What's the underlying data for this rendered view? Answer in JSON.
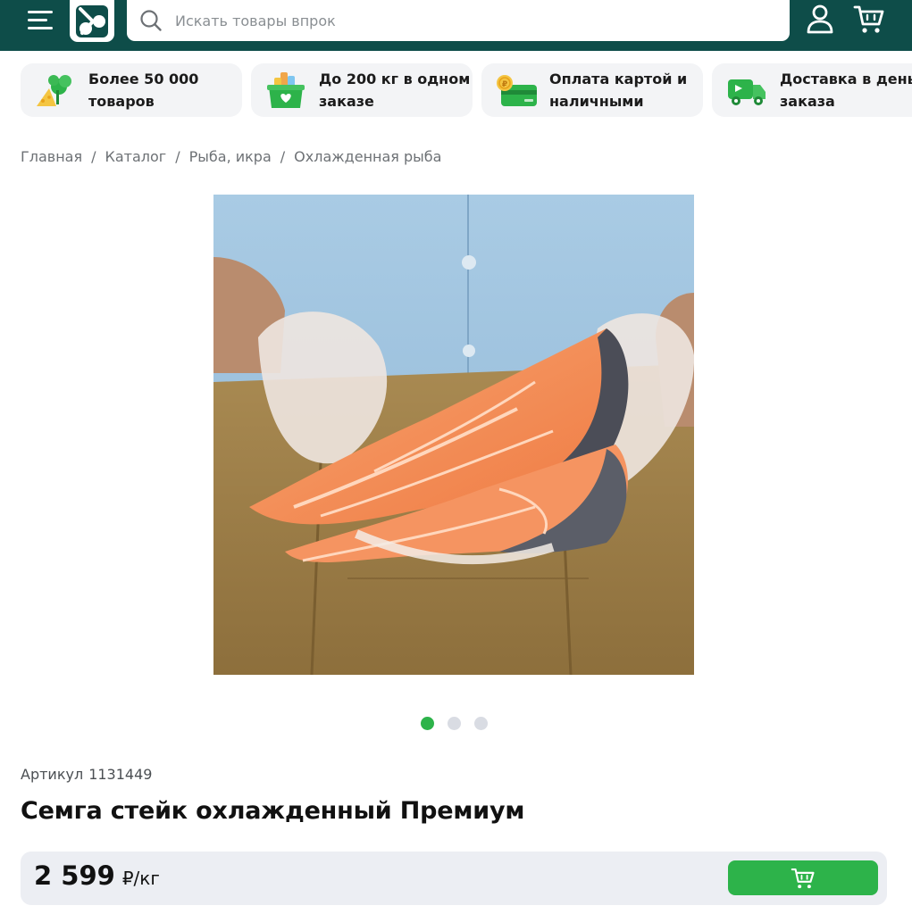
{
  "header": {
    "search_placeholder": "Искать товары впрок",
    "colors": {
      "background": "#0e4d49",
      "accent": "#2db34a"
    }
  },
  "features": [
    {
      "icon": "vegetables-icon",
      "line1": "Более 50 000",
      "line2": "товаров"
    },
    {
      "icon": "grocery-box-icon",
      "line1": "До 200 кг в одном",
      "line2": "заказе"
    },
    {
      "icon": "payment-card-icon",
      "line1": "Оплата картой и",
      "line2": "наличными"
    },
    {
      "icon": "delivery-truck-icon",
      "line1": "Доставка в день",
      "line2": "заказа"
    }
  ],
  "breadcrumb": [
    "Главная",
    "Каталог",
    "Рыба, икра",
    "Охлажденная рыба"
  ],
  "gallery": {
    "total_slides": 3,
    "active_slide": 1
  },
  "product": {
    "article_label": "Артикул",
    "article_number": "1131449",
    "title": "Семга стейк охлажденный Премиум",
    "price_value": "2 599",
    "price_unit": "₽/кг"
  }
}
